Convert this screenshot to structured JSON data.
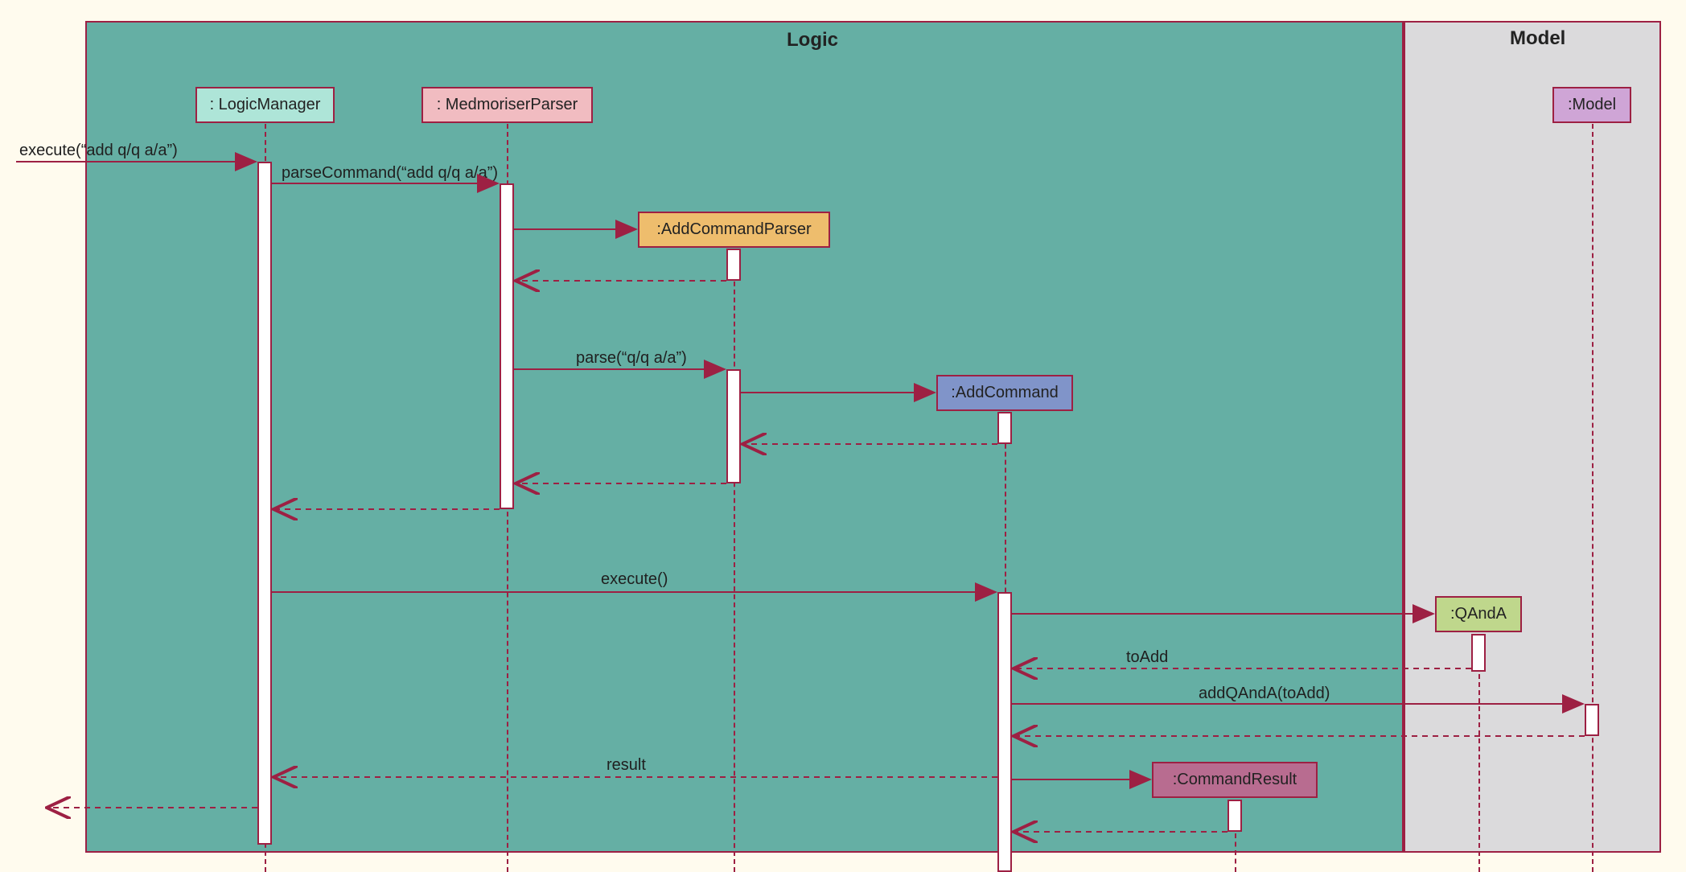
{
  "colors": {
    "border": "#9d2043",
    "logic_bg": "#65afa4",
    "model_bg": "#dbdadc",
    "logicManager": "#aee5d8",
    "medmoriserParser": "#f1bcc1",
    "addCommandParser": "#eebd6d",
    "addCommand": "#8094c9",
    "qAndA": "#bfd78c",
    "model": "#cfa5d6",
    "commandResult": "#b86c90"
  },
  "frames": {
    "logic": {
      "label": "Logic"
    },
    "model": {
      "label": "Model"
    }
  },
  "participants": {
    "logicManager": ": LogicManager",
    "medmoriserParser": ": MedmoriserParser",
    "addCommandParser": ":AddCommandParser",
    "addCommand": ":AddCommand",
    "qAndA": ":QAndA",
    "model": ":Model",
    "commandResult": ":CommandResult"
  },
  "messages": {
    "execute_in": "execute(“add q/q a/a”)",
    "parseCommand": "parseCommand(“add q/q a/a”)",
    "parse": "parse(“q/q a/a”)",
    "execute_out": "execute()",
    "toAdd": "toAdd",
    "addQAndA": "addQAndA(toAdd)",
    "result": "result"
  }
}
